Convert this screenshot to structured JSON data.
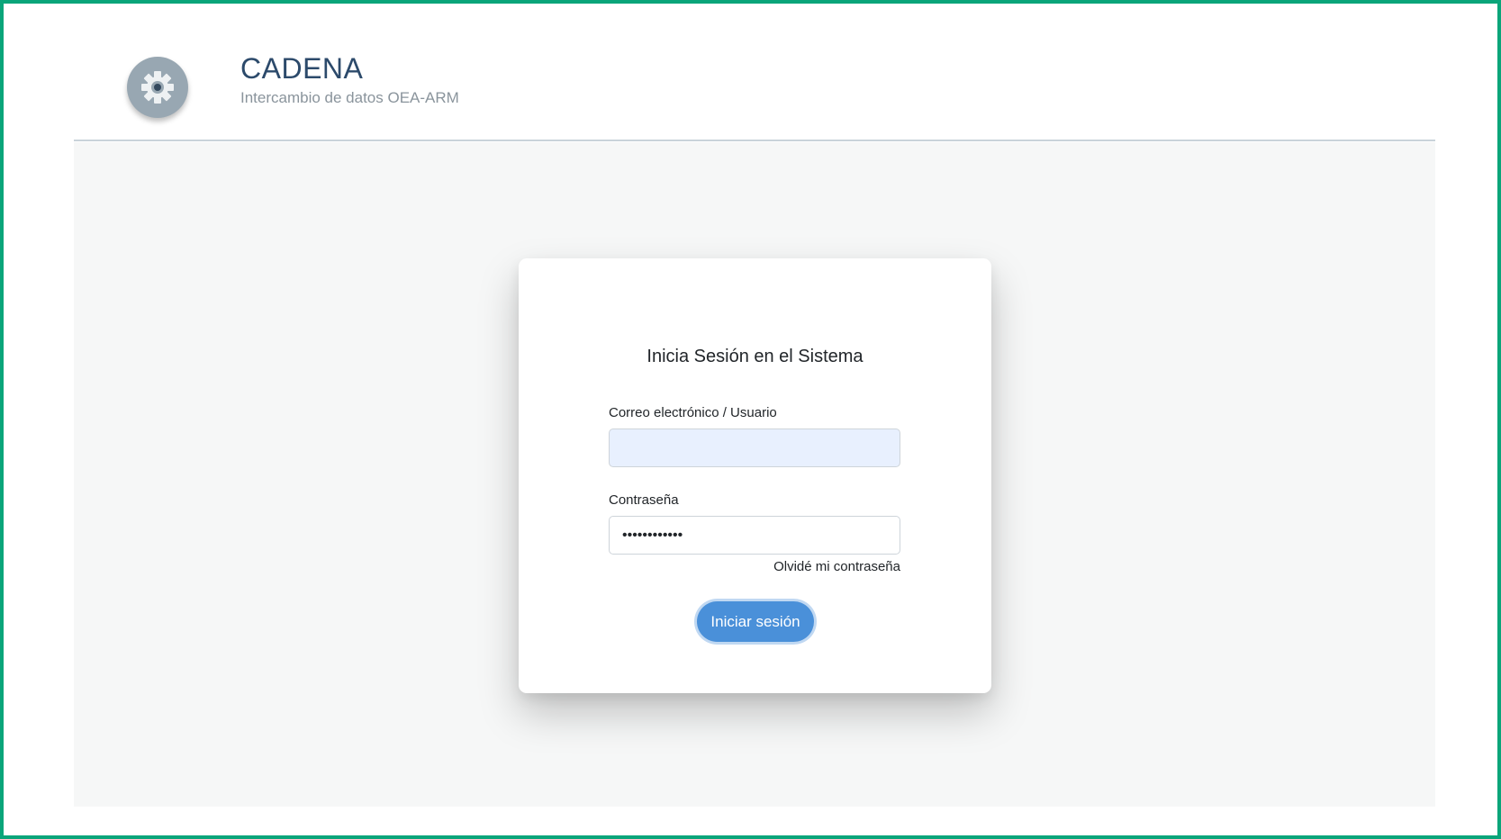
{
  "app": {
    "title": "CADENA",
    "subtitle": "Intercambio de datos OEA-ARM",
    "logo_icon": "gear-icon"
  },
  "login": {
    "heading": "Inicia Sesión en el Sistema",
    "email_label": "Correo electrónico / Usuario",
    "email_value": "",
    "password_label": "Contraseña",
    "password_value": "••••••••••••",
    "forgot_password": "Olvidé mi contraseña",
    "submit_label": "Iniciar sesión"
  },
  "colors": {
    "frame_border": "#0aa57a",
    "brand_title": "#2c4a6b",
    "primary_button": "#4a90d9",
    "email_autofill_bg": "#e8f0fe",
    "content_bg": "#f6f7f7"
  }
}
